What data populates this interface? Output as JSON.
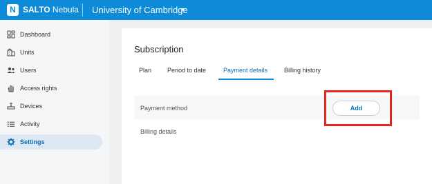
{
  "app": {
    "logo_letter": "N",
    "brand_strong": "SALTO",
    "brand_rest": " Nebula",
    "organization": "University of Cambridge",
    "accent_color": "#0d8ad8"
  },
  "sidebar": {
    "items": [
      {
        "label": "Dashboard",
        "icon": "dashboard-icon"
      },
      {
        "label": "Units",
        "icon": "building-icon"
      },
      {
        "label": "Users",
        "icon": "users-icon"
      },
      {
        "label": "Access rights",
        "icon": "hand-icon"
      },
      {
        "label": "Devices",
        "icon": "device-icon"
      },
      {
        "label": "Activity",
        "icon": "list-icon"
      },
      {
        "label": "Settings",
        "icon": "gear-icon",
        "active": true
      }
    ]
  },
  "main": {
    "title": "Subscription",
    "tabs": [
      {
        "label": "Plan"
      },
      {
        "label": "Period to date"
      },
      {
        "label": "Payment details",
        "active": true
      },
      {
        "label": "Billing history"
      }
    ],
    "payment_method_label": "Payment method",
    "add_label": "Add",
    "billing_details_label": "Billing details",
    "highlight_color": "#e8251a"
  }
}
